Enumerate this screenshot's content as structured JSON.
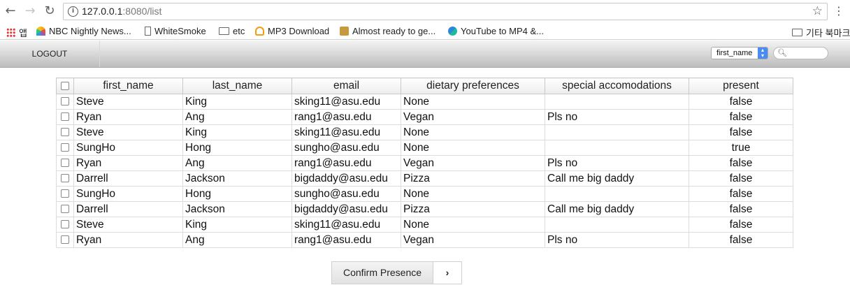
{
  "browser": {
    "url_host": "127.0.0.1",
    "url_rest": ":8080/list",
    "bookmarks": [
      {
        "label": "앱",
        "icon": "apps-grid-icon"
      },
      {
        "label": "NBC Nightly News...",
        "icon": "nbc-peacock-icon"
      },
      {
        "label": "WhiteSmoke",
        "icon": "page-icon"
      },
      {
        "label": "etc",
        "icon": "folder-icon"
      },
      {
        "label": "MP3 Download",
        "icon": "mp3-icon"
      },
      {
        "label": "Almost ready to ge...",
        "icon": "music-icon"
      },
      {
        "label": "YouTube to MP4 &...",
        "icon": "convert-icon"
      },
      {
        "label": "기타 북마크",
        "icon": "folder-icon"
      }
    ]
  },
  "appbar": {
    "logout_label": "LOGOUT",
    "filter_selected": "first_name"
  },
  "table": {
    "columns": [
      "first_name",
      "last_name",
      "email",
      "dietary preferences",
      "special accomodations",
      "present"
    ],
    "rows": [
      [
        "Steve",
        "King",
        "sking11@asu.edu",
        "None",
        "",
        "false"
      ],
      [
        "Ryan",
        "Ang",
        "rang1@asu.edu",
        "Vegan",
        "Pls no",
        "false"
      ],
      [
        "Steve",
        "King",
        "sking11@asu.edu",
        "None",
        "",
        "false"
      ],
      [
        "SungHo",
        "Hong",
        "sungho@asu.edu",
        "None",
        "",
        "true"
      ],
      [
        "Ryan",
        "Ang",
        "rang1@asu.edu",
        "Vegan",
        "Pls no",
        "false"
      ],
      [
        "Darrell",
        "Jackson",
        "bigdaddy@asu.edu",
        "Pizza",
        "Call me big daddy",
        "false"
      ],
      [
        "SungHo",
        "Hong",
        "sungho@asu.edu",
        "None",
        "",
        "false"
      ],
      [
        "Darrell",
        "Jackson",
        "bigdaddy@asu.edu",
        "Pizza",
        "Call me big daddy",
        "false"
      ],
      [
        "Steve",
        "King",
        "sking11@asu.edu",
        "None",
        "",
        "false"
      ],
      [
        "Ryan",
        "Ang",
        "rang1@asu.edu",
        "Vegan",
        "Pls no",
        "false"
      ]
    ]
  },
  "actions": {
    "confirm_label": "Confirm Presence",
    "next_label": "›"
  }
}
